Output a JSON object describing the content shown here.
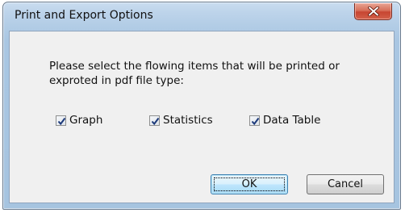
{
  "window": {
    "title": "Print and Export Options"
  },
  "dialog": {
    "prompt_line1": "Please select the flowing items that will be printed or",
    "prompt_line2": "exproted in pdf file type:",
    "options": [
      {
        "label": "Graph",
        "checked": true
      },
      {
        "label": "Statistics",
        "checked": true
      },
      {
        "label": "Data Table",
        "checked": true
      }
    ]
  },
  "buttons": {
    "ok_label": "OK",
    "cancel_label": "Cancel"
  },
  "colors": {
    "frame": "#a9c6e2",
    "close_button": "#c74632",
    "client_background": "#f0f0f0",
    "default_button_border": "#3c7fb1"
  },
  "icons": {
    "close": "close-x-icon",
    "checkmark": "checkmark-icon"
  }
}
